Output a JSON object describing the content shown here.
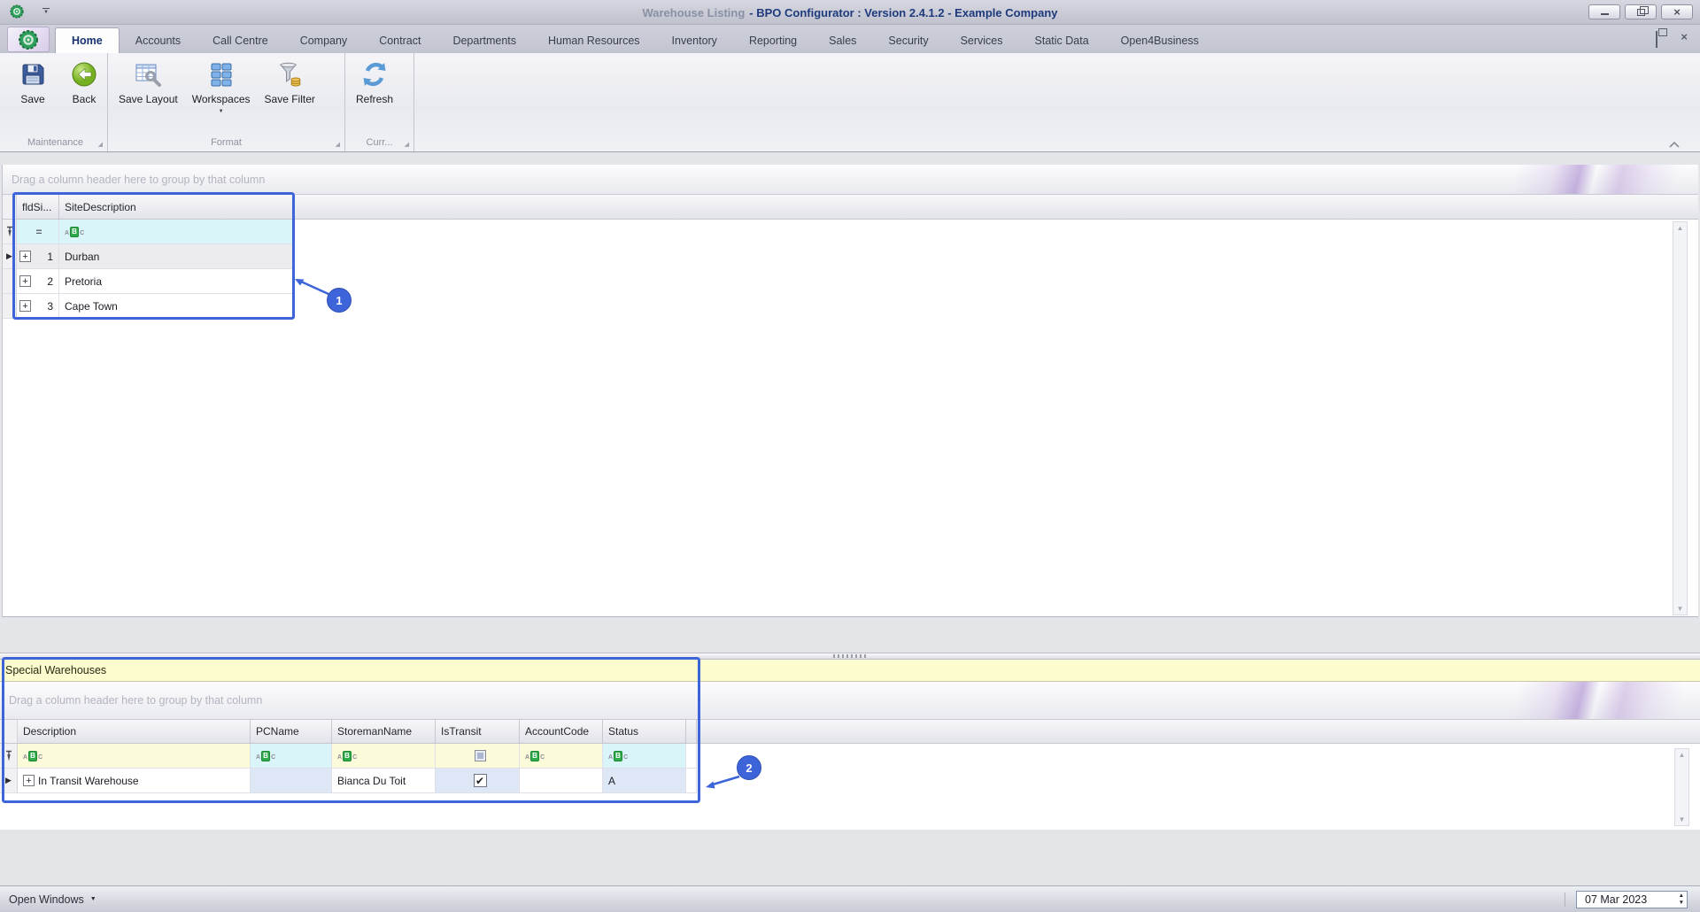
{
  "titlebar": {
    "title_primary": "Warehouse Listing",
    "title_secondary": "- BPO Configurator : Version 2.4.1.2 - Example Company"
  },
  "menu": {
    "tabs": [
      {
        "label": "Home",
        "active": true
      },
      {
        "label": "Accounts"
      },
      {
        "label": "Call Centre"
      },
      {
        "label": "Company"
      },
      {
        "label": "Contract"
      },
      {
        "label": "Departments"
      },
      {
        "label": "Human Resources"
      },
      {
        "label": "Inventory"
      },
      {
        "label": "Reporting"
      },
      {
        "label": "Sales"
      },
      {
        "label": "Security"
      },
      {
        "label": "Services"
      },
      {
        "label": "Static Data"
      },
      {
        "label": "Open4Business"
      }
    ]
  },
  "ribbon": {
    "groups": [
      {
        "label": "Maintenance",
        "buttons": [
          {
            "label": "Save"
          },
          {
            "label": "Back"
          }
        ]
      },
      {
        "label": "Format",
        "buttons": [
          {
            "label": "Save Layout"
          },
          {
            "label": "Workspaces",
            "dropdown": true
          },
          {
            "label": "Save Filter"
          }
        ]
      },
      {
        "label": "Curr...",
        "buttons": [
          {
            "label": "Refresh"
          }
        ]
      }
    ]
  },
  "top_grid": {
    "group_hint": "Drag a column header here to group by that column",
    "columns": [
      {
        "label": "fldSi..."
      },
      {
        "label": "SiteDescription"
      }
    ],
    "rows": [
      {
        "num": "1",
        "site": "Durban",
        "selected": true
      },
      {
        "num": "2",
        "site": "Pretoria"
      },
      {
        "num": "3",
        "site": "Cape Town"
      }
    ]
  },
  "bottom_panel": {
    "title": "Special Warehouses",
    "group_hint": "Drag a column header here to group by that column",
    "columns": [
      {
        "label": "Description"
      },
      {
        "label": "PCName"
      },
      {
        "label": "StoremanName"
      },
      {
        "label": "IsTransit"
      },
      {
        "label": "AccountCode"
      },
      {
        "label": "Status"
      }
    ],
    "row": {
      "description": "In Transit Warehouse",
      "pcname": "",
      "storeman_name": "Bianca Du Toit",
      "is_transit": true,
      "account_code": "",
      "status": "A"
    }
  },
  "statusbar": {
    "open_windows_label": "Open Windows",
    "date_value": "07 Mar 2023"
  },
  "annotations": {
    "badge1": "1",
    "badge2": "2"
  },
  "icons": {
    "filter_equals": "=",
    "abc_a": "A",
    "abc_b": "B",
    "abc_c": "C",
    "row_indicator": "▶",
    "expand_plus": "+",
    "check": "✔",
    "caret_down": "▼",
    "arrow_up": "▲",
    "arrow_down": "▼",
    "close": "×",
    "launcher": "◢"
  },
  "colors": {
    "annotation_blue": "#3d64d9",
    "panel_yellow": "#fcfccf",
    "filter_cyan": "#daf5fa",
    "filter_yellow": "#fbfbda",
    "readonly_blue": "#dde7f6",
    "accent_green": "#2faa4a",
    "title_navy": "#1e3a7c"
  }
}
